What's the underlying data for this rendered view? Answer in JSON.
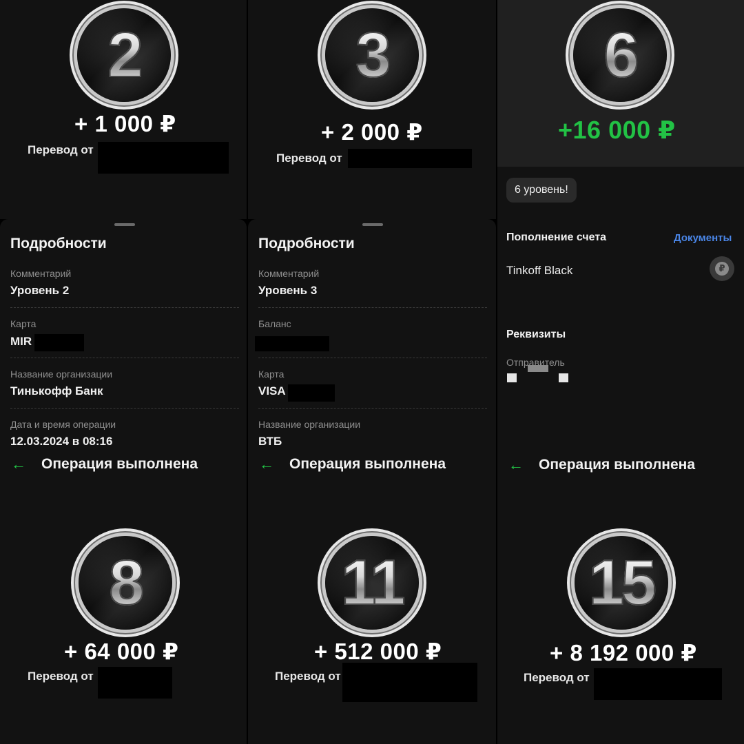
{
  "panels": [
    {
      "level": "2",
      "amount": "+ 1 000 ₽",
      "from_label": "Перевод от"
    },
    {
      "level": "3",
      "amount": "+ 2 000 ₽",
      "from_label": "Перевод от"
    },
    {
      "level": "6",
      "amount": "+16 000 ₽"
    },
    {
      "level": "8",
      "amount": "+ 64 000 ₽",
      "from_label": "Перевод от"
    },
    {
      "level": "11",
      "amount": "+ 512 000 ₽",
      "from_label": "Перевод от"
    },
    {
      "level": "15",
      "amount": "+ 8 192 000 ₽",
      "from_label": "Перевод от"
    }
  ],
  "details_a": {
    "title": "Подробности",
    "fields": [
      {
        "label": "Комментарий",
        "value": "Уровень 2"
      },
      {
        "label": "Карта",
        "value": "MIR"
      },
      {
        "label": "Название организации",
        "value": "Тинькофф Банк"
      },
      {
        "label": "Дата и время операции",
        "value": "12.03.2024 в 08:16"
      }
    ]
  },
  "details_b": {
    "title": "Подробности",
    "fields": [
      {
        "label": "Комментарий",
        "value": "Уровень 3"
      },
      {
        "label": "Баланс",
        "value": ""
      },
      {
        "label": "Карта",
        "value": "VISA"
      },
      {
        "label": "Название организации",
        "value": "ВТБ"
      }
    ]
  },
  "tinkoff": {
    "chip": "6 уровень!",
    "section1": "Пополнение счета",
    "documents_link": "Документы",
    "account": "Tinkoff Black",
    "rub_icon": "₽",
    "section2": "Реквизиты",
    "sender_label": "Отправитель"
  },
  "back_rows": [
    {
      "title": "Операция выполнена"
    },
    {
      "title": "Операция выполнена"
    },
    {
      "title": "Операция выполнена"
    }
  ],
  "colors": {
    "success_green": "#22c245",
    "link_blue": "#4a86e8"
  }
}
